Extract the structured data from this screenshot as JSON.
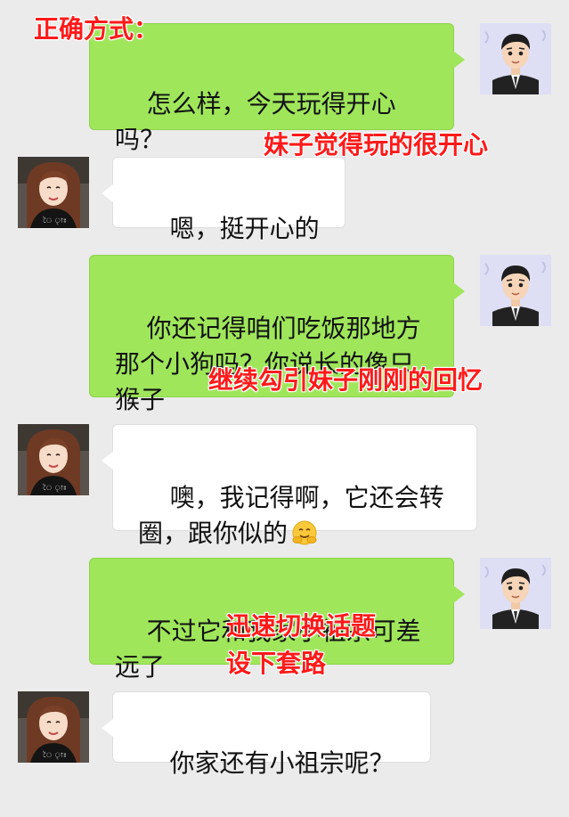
{
  "messages": [
    {
      "side": "me",
      "text": "怎么样，今天玩得开心吗？"
    },
    {
      "side": "her",
      "text": "嗯，挺开心的"
    },
    {
      "side": "me",
      "text": "你还记得咱们吃饭那地方那个小狗吗？你说长的像只猴子"
    },
    {
      "side": "her",
      "text": "噢，我记得啊，它还会转圈，跟你似的",
      "emoji": "hugging-face-emoji"
    },
    {
      "side": "me",
      "text": "不过它和我家小祖宗可差远了"
    },
    {
      "side": "her",
      "text": "你家还有小祖宗呢？"
    }
  ],
  "annotations": {
    "a1": "正确方式：",
    "a2": "妹子觉得玩的很开心",
    "a3": "继续勾引妹子刚刚的回忆",
    "a4": "迅速切换话题",
    "a5": "设下套路"
  },
  "colors": {
    "background": "#ebebeb",
    "my_bubble": "#9fe65b",
    "her_bubble": "#ffffff",
    "annotation": "#ff1a1a"
  },
  "icons": {
    "male_avatar": "cartoon-man-avatar",
    "female_avatar": "girl-photo-avatar"
  }
}
